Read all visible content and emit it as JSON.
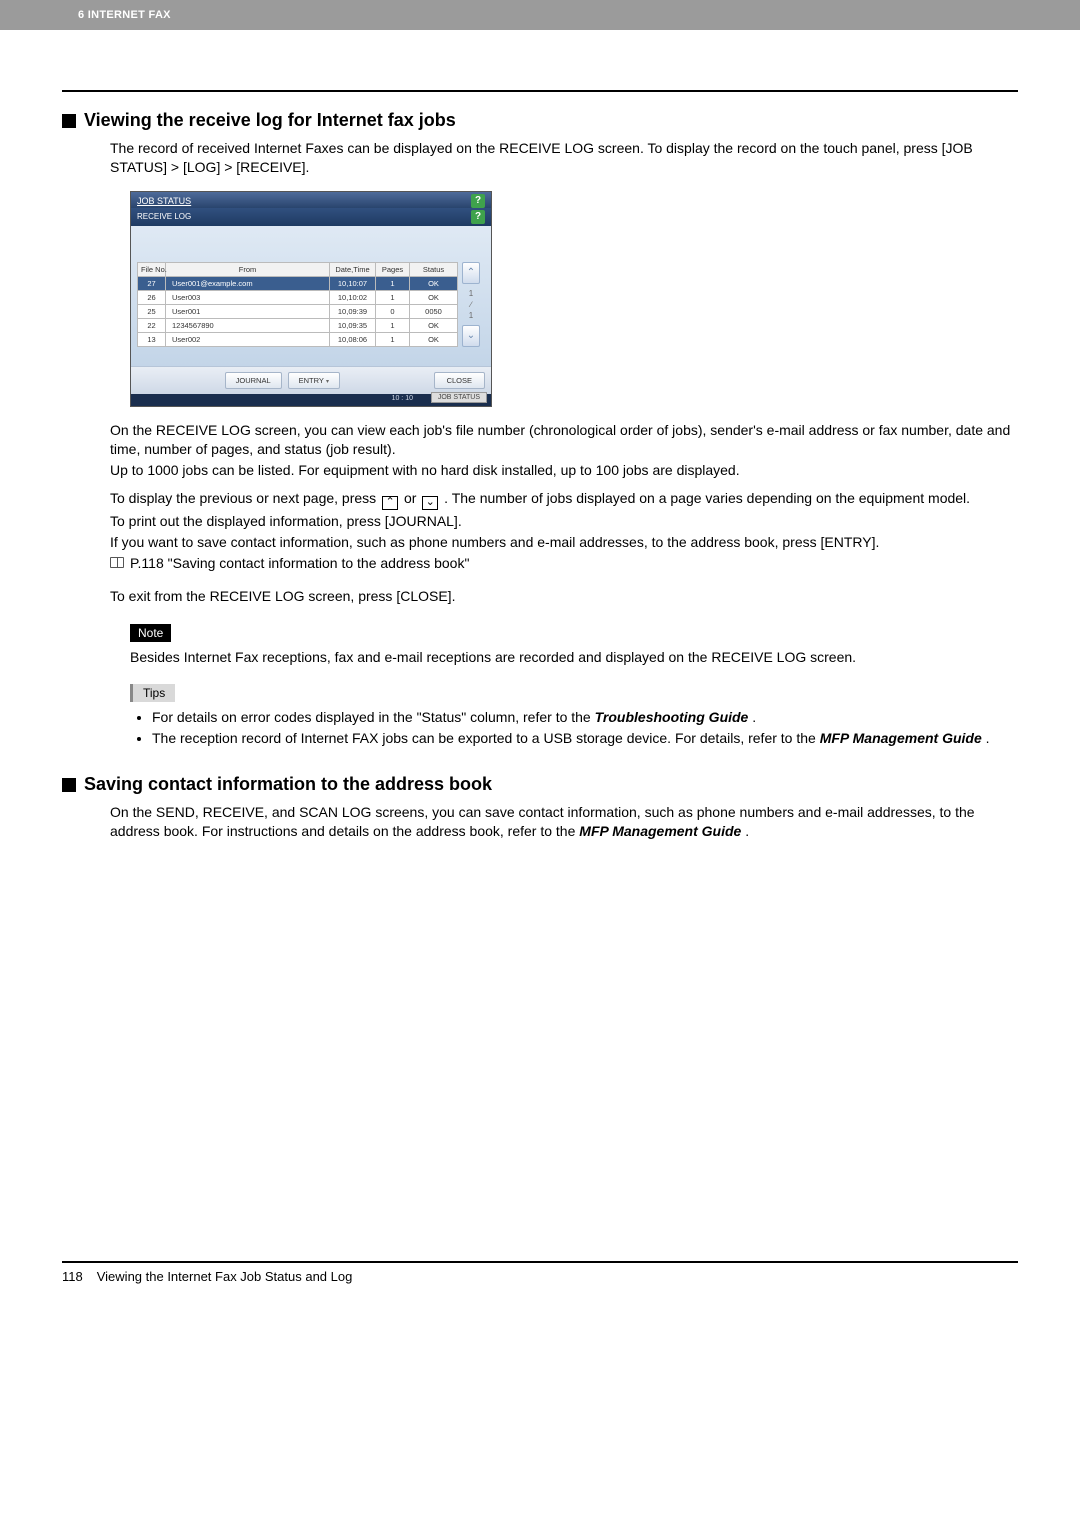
{
  "header": {
    "chapter_label": "6 INTERNET FAX"
  },
  "section1": {
    "title": "Viewing the receive log for Internet fax jobs",
    "intro": "The record of received Internet Faxes can be displayed on the RECEIVE LOG screen. To display the record on the touch panel, press [JOB STATUS] > [LOG] > [RECEIVE].",
    "p1": "On the RECEIVE LOG screen, you can view each job's file number (chronological order of jobs), sender's e-mail address or fax number, date and time, number of pages, and status (job result).",
    "p2": "Up to 1000 jobs can be listed. For equipment with no hard disk installed, up to 100 jobs are displayed.",
    "nav_pre": "To display the previous or next page, press ",
    "nav_mid": " or ",
    "nav_post": ". The number of jobs displayed on a page varies depending on the equipment model.",
    "print_line": "To print out the displayed information, press [JOURNAL].",
    "save_line": "If you want to save contact information, such as phone numbers and e-mail addresses, to the address book, press [ENTRY].",
    "ref_text": "P.118 \"Saving contact information to the address book\"",
    "exit_line": "To exit from the RECEIVE LOG screen, press [CLOSE]."
  },
  "screenshot": {
    "title": "JOB STATUS",
    "subtitle": "RECEIVE LOG",
    "help": "?",
    "headers": {
      "file": "File No.",
      "from": "From",
      "date": "Date,Time",
      "pages": "Pages",
      "status": "Status"
    },
    "rows": [
      {
        "file": "27",
        "from": "User001@example.com",
        "date": "10,10:07",
        "pages": "1",
        "status": "OK",
        "selected": true
      },
      {
        "file": "26",
        "from": "User003",
        "date": "10,10:02",
        "pages": "1",
        "status": "OK"
      },
      {
        "file": "25",
        "from": "User001",
        "date": "10,09:39",
        "pages": "0",
        "status": "0050"
      },
      {
        "file": "22",
        "from": "1234567890",
        "date": "10,09:35",
        "pages": "1",
        "status": "OK"
      },
      {
        "file": "13",
        "from": "User002",
        "date": "10,08:06",
        "pages": "1",
        "status": "OK"
      }
    ],
    "page_indicator": {
      "top": "1",
      "sep": "∕",
      "bot": "1"
    },
    "buttons": {
      "journal": "JOURNAL",
      "entry": "ENTRY",
      "close": "CLOSE"
    },
    "statusbar": {
      "chip": "JOB STATUS",
      "time": "10 : 10"
    }
  },
  "note": {
    "label": "Note",
    "text": "Besides Internet Fax receptions, fax and e-mail receptions are recorded and displayed on the RECEIVE LOG screen."
  },
  "tips": {
    "label": "Tips",
    "item1_pre": "For details on error codes displayed in the \"Status\" column, refer to the ",
    "item1_em": "Troubleshooting Guide",
    "item1_post": ".",
    "item2_pre": "The reception record of Internet FAX jobs can be exported to a USB storage device. For details, refer to the ",
    "item2_em": "MFP Management Guide",
    "item2_post": "."
  },
  "section2": {
    "title": "Saving contact information to the address book",
    "text_pre": "On the SEND, RECEIVE, and SCAN LOG screens, you can save contact information, such as phone numbers and e-mail addresses, to the address book. For instructions and details on the address book, refer to the ",
    "text_em": "MFP Management Guide",
    "text_post": "."
  },
  "footer": {
    "page_no": "118",
    "title": "Viewing the Internet Fax Job Status and Log"
  }
}
